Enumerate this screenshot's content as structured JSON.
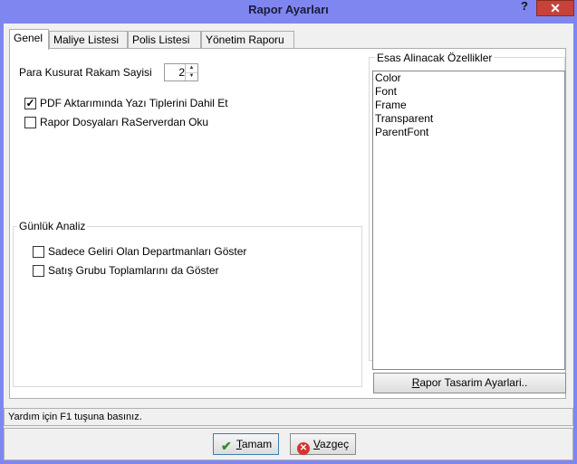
{
  "window": {
    "title": "Rapor Ayarları",
    "help": "?",
    "close": "✕"
  },
  "tabs": [
    {
      "label": "Genel"
    },
    {
      "label": "Maliye Listesi"
    },
    {
      "label": "Polis Listesi"
    },
    {
      "label": "Yönetim Raporu"
    }
  ],
  "genel": {
    "para_label": "Para Kusurat Rakam Sayisi",
    "para_value": "2",
    "pdf_fonts": {
      "label": "PDF Aktarımında Yazı Tiplerini Dahil Et",
      "checked": true
    },
    "raserver": {
      "label": "Rapor Dosyaları RaServerdan Oku",
      "checked": false
    }
  },
  "gunluk": {
    "title": "Günlük Analiz",
    "sadece": {
      "label": "Sadece Geliri Olan Departmanları Göster",
      "checked": false
    },
    "satis": {
      "label": "Satış Grubu Toplamlarını da Göster",
      "checked": false
    }
  },
  "ozellikler": {
    "title": "Esas Alinacak Özellikler",
    "items": [
      "Color",
      "Font",
      "Frame",
      "Transparent",
      "ParentFont"
    ]
  },
  "tasarim_button": {
    "label_u": "R",
    "label_rest": "apor Tasarim Ayarlari.."
  },
  "status": "Yardım için F1 tuşuna basınız.",
  "ok_button": {
    "label_u": "T",
    "label_rest": "amam"
  },
  "cancel_button": {
    "label_u": "V",
    "label_rest": "azgeç"
  },
  "colors": {
    "titlebar": "#7f86f0",
    "close": "#c7423a"
  }
}
